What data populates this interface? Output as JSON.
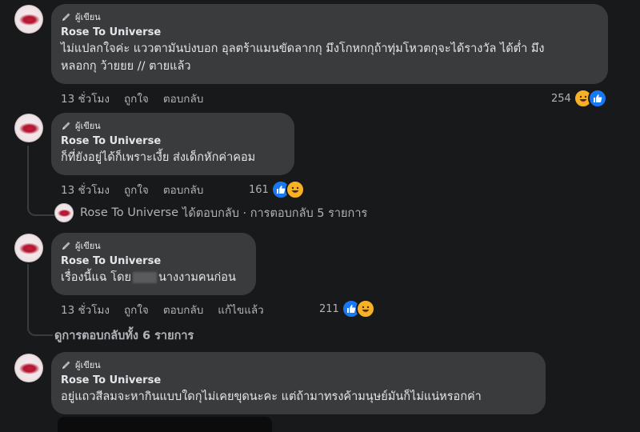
{
  "author_badge": "ผู้เขียน",
  "comments": [
    {
      "name": "Rose To Universe",
      "line1": "ไม่แปลกใจค่ะ แววตามันบ่งบอก อุลตร้าแมนขัดลากกุ มึงโกหกกุถ้าทุ่มโหวตกุจะได้รางวัล ได้ต่ำ มึง",
      "line2": "หลอกกุ ว้ายยย // ตายแล้ว",
      "time": "13 ชั่วโมง",
      "like": "ถูกใจ",
      "reply": "ตอบกลับ",
      "reactions": "254"
    },
    {
      "name": "Rose To Universe",
      "line1": "ก็ที่ยังอยู่ได้ก็เพราะเงี้ย ส่งเด็กหักค่าคอม",
      "time": "13 ชั่วโมง",
      "like": "ถูกใจ",
      "reply": "ตอบกลับ",
      "reactions": "161"
    },
    {
      "name": "Rose To Universe",
      "text_before": "เรื่องนี้แฉ โดย",
      "text_after": "นางงามคนก่อน",
      "time": "13 ชั่วโมง",
      "like": "ถูกใจ",
      "reply": "ตอบกลับ",
      "edited": "แก้ไขแล้ว",
      "reactions": "211"
    },
    {
      "name": "Rose To Universe",
      "line1": "อยู่แถวสีลมจะหากินแบบใดกุไม่เคยขุดนะคะ แต่ถ้ามาทรงค้ามนุษย์มันก็ไม่แน่หรอกค่า"
    }
  ],
  "reply_summary": {
    "name": "Rose To Universe",
    "text": "ได้ตอบกลับ · การตอบกลับ 5 รายการ"
  },
  "view_all_replies": "ดูการตอบกลับทั้ง 6 รายการ"
}
